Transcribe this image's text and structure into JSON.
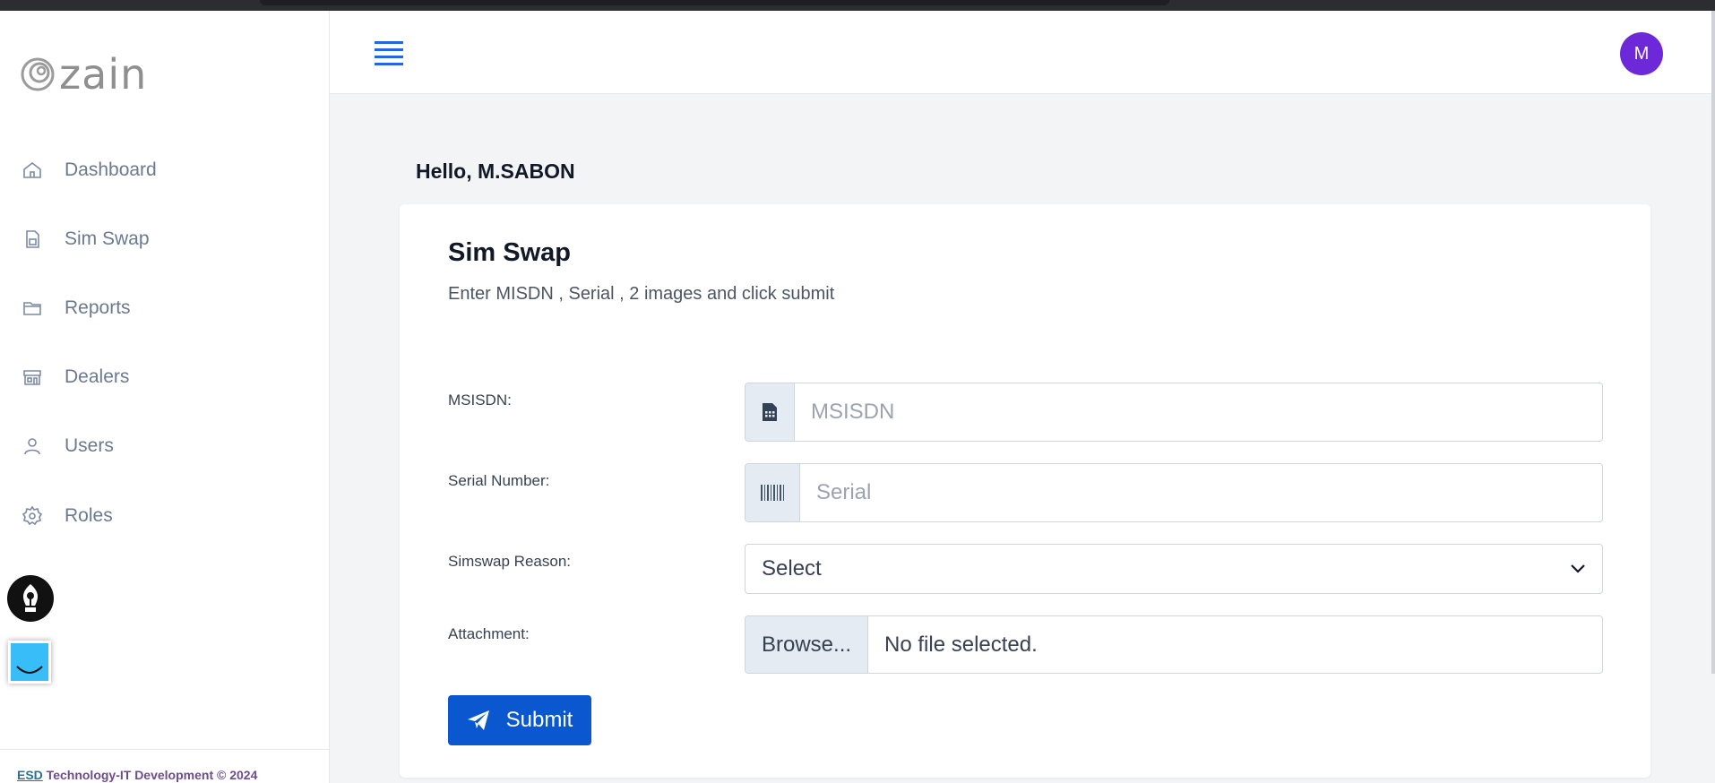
{
  "app": {
    "logo_text": "zain"
  },
  "sidebar": {
    "items": [
      {
        "label": "Dashboard",
        "icon": "home-icon"
      },
      {
        "label": "Sim Swap",
        "icon": "sim-card-icon"
      },
      {
        "label": "Reports",
        "icon": "folder-icon"
      },
      {
        "label": "Dealers",
        "icon": "store-icon"
      },
      {
        "label": "Users",
        "icon": "user-icon"
      },
      {
        "label": "Roles",
        "icon": "gear-icon"
      }
    ],
    "footer": {
      "company": "ESD",
      "rest": " Technology-IT Development © 2024"
    }
  },
  "topbar": {
    "avatar_initial": "M"
  },
  "main": {
    "greeting": "Hello, M.SABON",
    "card": {
      "title": "Sim Swap",
      "subtitle": "Enter MISDN , Serial , 2 images and click submit"
    },
    "form": {
      "msisdn": {
        "label": "MSISDN:",
        "placeholder": "MSISDN"
      },
      "serial": {
        "label": "Serial Number:",
        "placeholder": "Serial"
      },
      "reason": {
        "label": "Simswap Reason:",
        "selected": "Select"
      },
      "attachment": {
        "label": "Attachment:",
        "browse": "Browse...",
        "status": "No file selected."
      },
      "submit_label": "Submit"
    }
  },
  "colors": {
    "primary": "#0b57d0",
    "avatar": "#6d28d9",
    "hamburger": "#2563eb"
  }
}
